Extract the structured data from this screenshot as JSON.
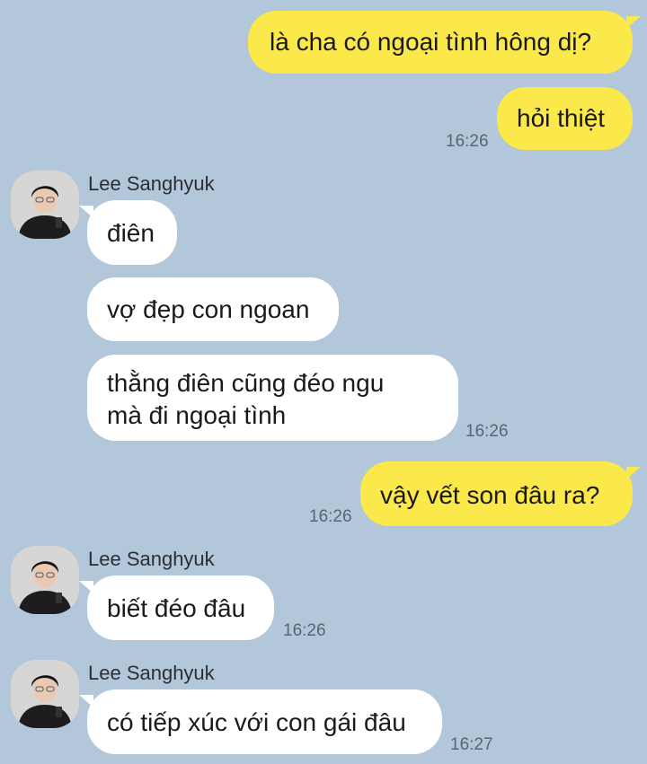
{
  "contact": {
    "name": "Lee Sanghyuk"
  },
  "messages": [
    {
      "text": "là cha có ngoại tình hông dị?"
    },
    {
      "text": "hỏi thiệt",
      "time": "16:26"
    },
    {
      "text": "điên"
    },
    {
      "text": "vợ đẹp con ngoan"
    },
    {
      "line1": "thằng điên cũng đéo ngu",
      "line2": "mà đi ngoại tình",
      "time": "16:26"
    },
    {
      "text": "vậy vết son đâu ra?",
      "time": "16:26"
    },
    {
      "text": "biết đéo đâu",
      "time": "16:26"
    },
    {
      "text": "có tiếp xúc với con gái đâu",
      "time": "16:27"
    }
  ],
  "colors": {
    "background": "#b2c7da",
    "outgoing_bubble": "#fbe84a",
    "incoming_bubble": "#ffffff"
  }
}
